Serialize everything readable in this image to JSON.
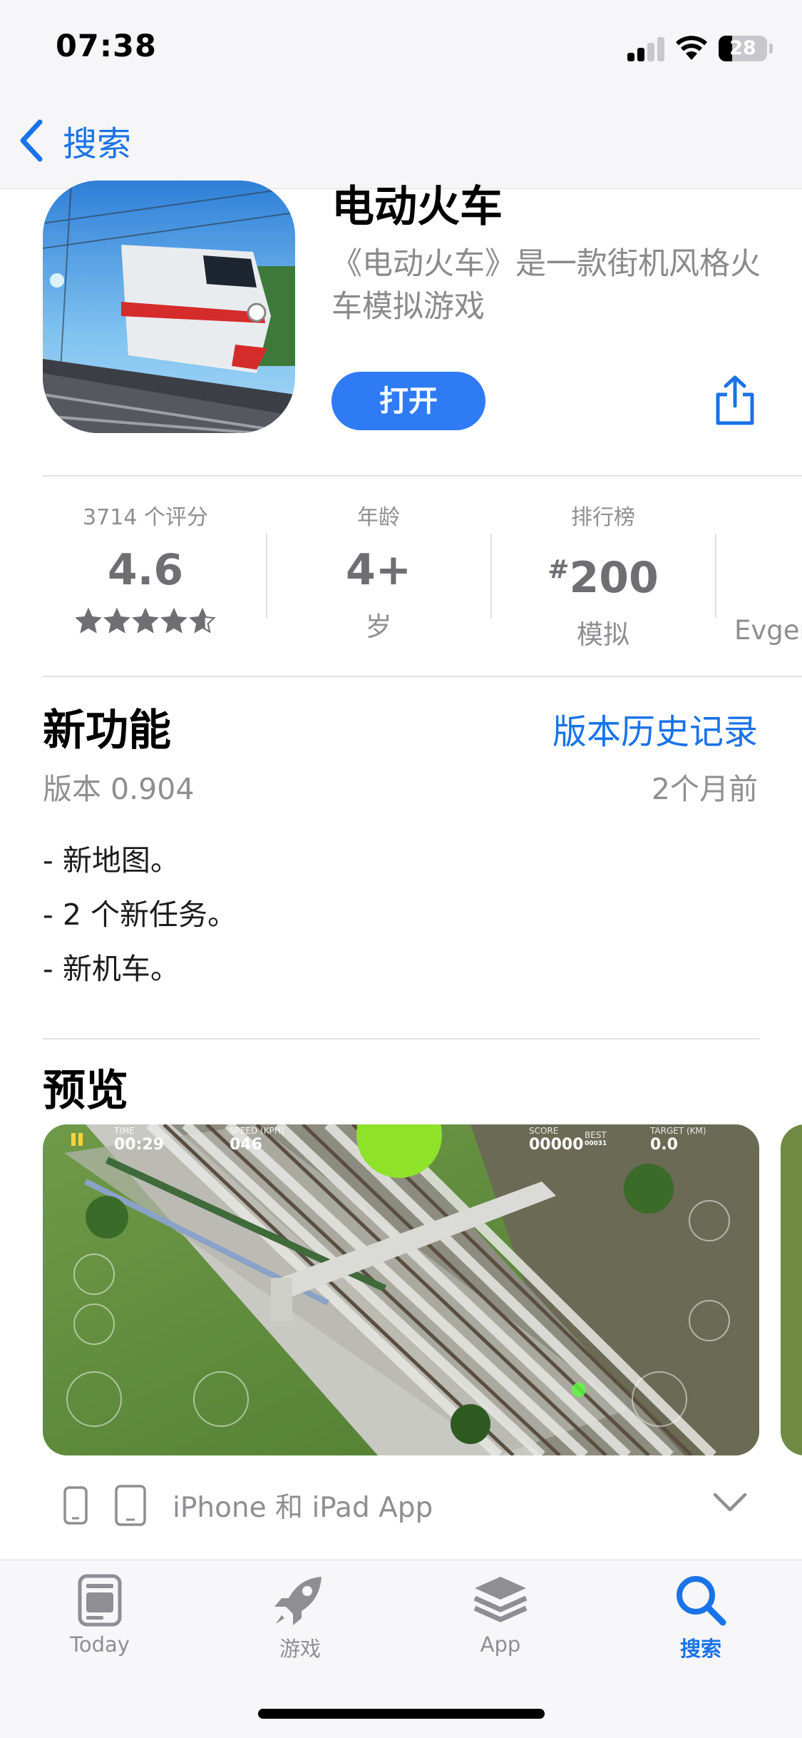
{
  "status_bar": {
    "time": "07:38",
    "battery_level": "28"
  },
  "nav": {
    "back_label": "搜索"
  },
  "app": {
    "title": "电动火车",
    "subtitle": "《电动火车》是一款街机风格火车模拟游戏",
    "open_label": "打开"
  },
  "info": {
    "ratings_label": "3714 个评分",
    "rating_value": "4.6",
    "rating_stars": 4.6,
    "age_label": "年龄",
    "age_value": "4+",
    "age_sub": "岁",
    "chart_label": "排行榜",
    "chart_hash": "#",
    "chart_value": "200",
    "chart_sub": "模拟",
    "developer": "Evger"
  },
  "whats_new": {
    "title": "新功能",
    "history_link": "版本历史记录",
    "version": "版本 0.904",
    "date": "2个月前",
    "notes": [
      "- 新地图。",
      "- 2 个新任务。",
      "- 新机车。"
    ]
  },
  "preview": {
    "title": "预览",
    "hud": {
      "time_label": "TIME",
      "time_value": "00:29",
      "speed_label": "SPEED (KPH)",
      "speed_value": "046",
      "score_label": "SCORE",
      "score_value": "00000",
      "best_label": "BEST",
      "best_value": "00031",
      "target_label": "TARGET (KM)",
      "target_value": "0.0"
    },
    "devices_label": "iPhone 和 iPad App"
  },
  "tabs": [
    {
      "label": "Today",
      "icon": "today-icon",
      "active": false
    },
    {
      "label": "游戏",
      "icon": "rocket-icon",
      "active": false
    },
    {
      "label": "App",
      "icon": "layers-icon",
      "active": false
    },
    {
      "label": "搜索",
      "icon": "search-icon",
      "active": true
    }
  ],
  "colors": {
    "accent": "#1a73e8",
    "button": "#2f7bf5"
  }
}
